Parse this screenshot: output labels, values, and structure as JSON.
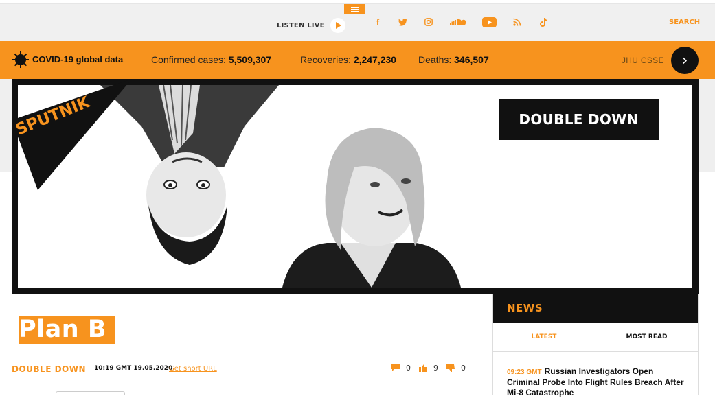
{
  "header": {
    "menu_icon": "hamburger-icon",
    "listen_live": "LISTEN LIVE",
    "search": "SEARCH",
    "social": [
      "facebook-icon",
      "twitter-icon",
      "instagram-icon",
      "soundcloud-icon",
      "youtube-icon",
      "rss-icon",
      "tiktok-icon"
    ]
  },
  "covid": {
    "title": "COVID-19 global data",
    "confirmed_label": "Confirmed cases:",
    "confirmed_value": "5,509,307",
    "recoveries_label": "Recoveries:",
    "recoveries_value": "2,247,230",
    "deaths_label": "Deaths:",
    "deaths_value": "346,507",
    "source": "JHU CSSE"
  },
  "banner": {
    "logo_text": "SPUTNIK",
    "show_badge": "DOUBLE DOWN"
  },
  "article": {
    "title": "Plan B",
    "brand": "DOUBLE DOWN",
    "date": "10:19 GMT 19.05.2020",
    "short_url": "Get short URL",
    "comments": "0",
    "likes": "9",
    "dislikes": "0"
  },
  "news": {
    "heading": "NEWS",
    "tab_latest": "LATEST",
    "tab_most_read": "MOST READ",
    "items": [
      {
        "time": "09:23 GMT",
        "title": "Russian Investigators Open Criminal Probe Into Flight Rules Breach After Mi-8 Catastrophe"
      }
    ]
  },
  "colors": {
    "accent": "#f7931e",
    "dark": "#111111",
    "header_bg": "#f0f0f0"
  }
}
